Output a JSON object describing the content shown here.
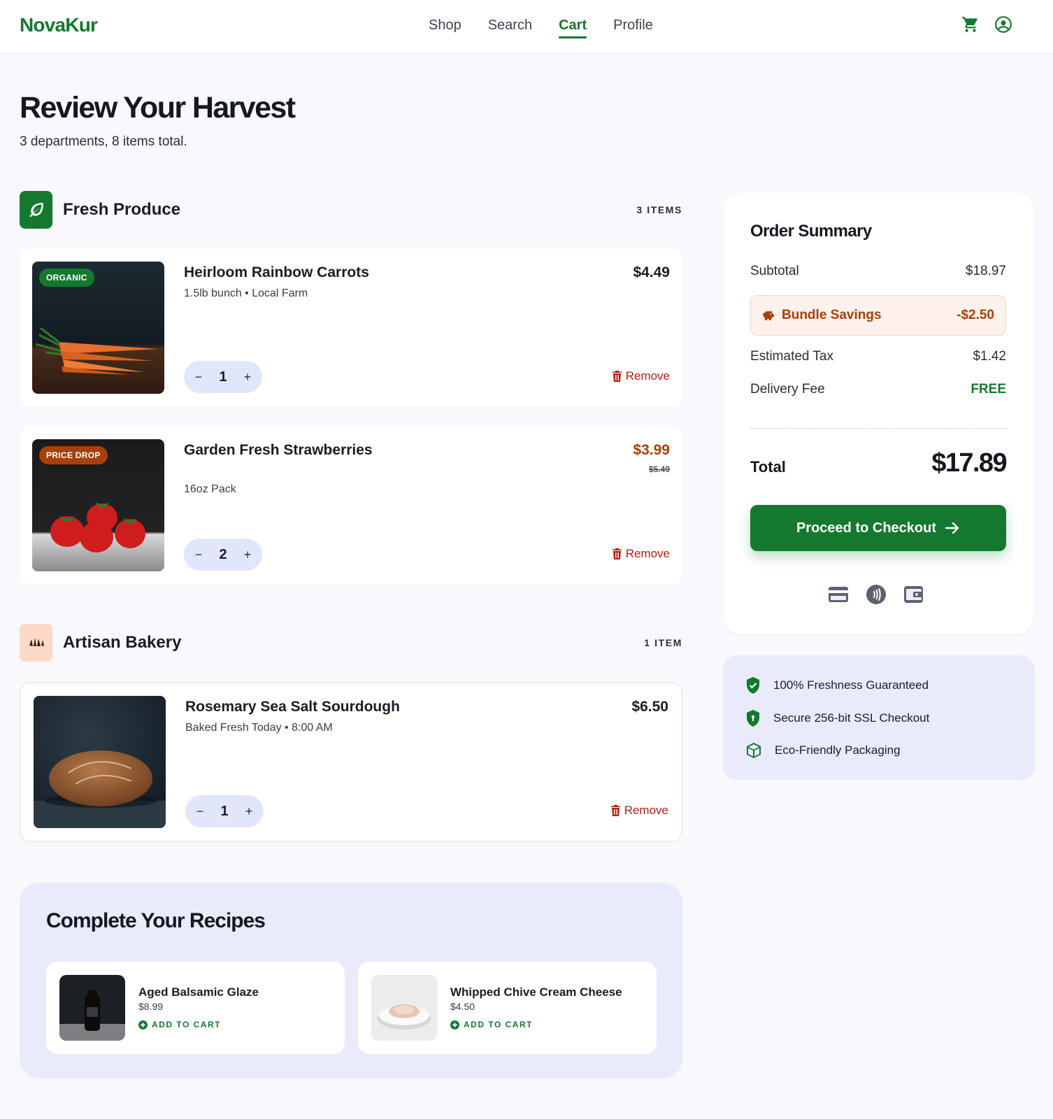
{
  "header": {
    "logo": "NovaKur",
    "nav": [
      "Shop",
      "Search",
      "Cart",
      "Profile"
    ],
    "active_nav": "Cart",
    "icons": [
      "cart-icon",
      "account-icon"
    ]
  },
  "page": {
    "title": "Review Your Harvest",
    "subtitle": "3 departments, 8 items total."
  },
  "departments": [
    {
      "title": "Fresh Produce",
      "count": "3 ITEMS",
      "icon": "leaf-icon",
      "items": [
        {
          "name": "Heirloom Rainbow Carrots",
          "meta": "1.5lb bunch • Local Farm",
          "price": "$4.49",
          "badge": "ORGANIC",
          "qty": "1",
          "remove": "Remove"
        },
        {
          "name": "Garden Fresh Strawberries",
          "meta": "16oz Pack",
          "price": "$3.99",
          "old_price": "$5.49",
          "badge": "PRICE DROP",
          "qty": "2",
          "remove": "Remove"
        }
      ]
    },
    {
      "title": "Artisan Bakery",
      "count": "1 ITEM",
      "icon": "croissant-icon",
      "items": [
        {
          "name": "Rosemary Sea Salt Sourdough",
          "meta": "Baked Fresh Today • 8:00 AM",
          "price": "$6.50",
          "qty": "1",
          "remove": "Remove"
        }
      ]
    }
  ],
  "recipes": {
    "title": "Complete Your Recipes",
    "items": [
      {
        "name": "Aged Balsamic Glaze",
        "price": "$8.99",
        "action": "ADD TO CART"
      },
      {
        "name": "Whipped Chive Cream Cheese",
        "price": "$4.50",
        "action": "ADD TO CART"
      }
    ]
  },
  "summary": {
    "title": "Order Summary",
    "subtotal_label": "Subtotal",
    "subtotal": "$18.97",
    "savings_label": "Bundle Savings",
    "savings": "-$2.50",
    "tax_label": "Estimated Tax",
    "tax": "$1.42",
    "delivery_label": "Delivery Fee",
    "delivery": "FREE",
    "total_label": "Total",
    "total": "$17.89",
    "checkout": "Proceed to Checkout",
    "payment_icons": [
      "credit-card-icon",
      "contactless-icon",
      "wallet-icon"
    ]
  },
  "trust": [
    {
      "icon": "shield-check-icon",
      "text": "100% Freshness Guaranteed"
    },
    {
      "icon": "shield-lock-icon",
      "text": "Secure 256-bit SSL Checkout"
    },
    {
      "icon": "package-icon",
      "text": "Eco-Friendly Packaging"
    }
  ],
  "colors": {
    "brand": "#14792f",
    "sale": "#a8400a",
    "remove": "#b71d10",
    "background": "#f8f8fd"
  }
}
